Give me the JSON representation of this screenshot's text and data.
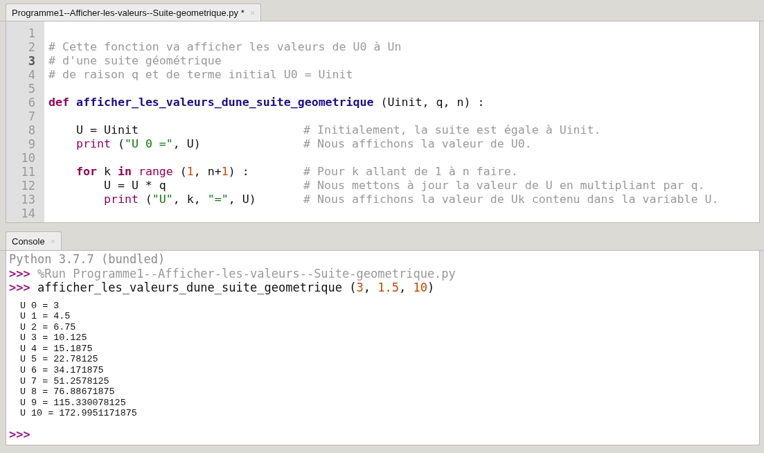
{
  "editor": {
    "tab": {
      "title": "Programme1--Afficher-les-valeurs--Suite-geometrique.py *"
    },
    "lines": [
      {
        "number": "1",
        "current": false
      },
      {
        "number": "2",
        "current": false,
        "tokens": [
          {
            "kind": "comment",
            "text": "# Cette fonction va afficher les valeurs de U0 à Un"
          }
        ]
      },
      {
        "number": "3",
        "current": true,
        "tokens": [
          {
            "kind": "comment",
            "text": "# d'une suite géométrique"
          }
        ]
      },
      {
        "number": "4",
        "current": false,
        "tokens": [
          {
            "kind": "comment",
            "text": "# de raison q et de terme initial U0 = Uinit"
          }
        ]
      },
      {
        "number": "5",
        "current": false
      },
      {
        "number": "6",
        "current": false,
        "tokens": [
          {
            "kind": "keyword",
            "text": "def"
          },
          {
            "kind": "defname",
            "text": " afficher_les_valeurs_dune_suite_geometrique"
          },
          {
            "kind": "plain",
            "text": " (Uinit, q, n) :"
          }
        ]
      },
      {
        "number": "7",
        "current": false
      },
      {
        "number": "8",
        "current": false,
        "tokens": [
          {
            "kind": "plain",
            "text": "    U = Uinit"
          }
        ],
        "comment": "# Initialement, la suite est égale à Uinit."
      },
      {
        "number": "9",
        "current": false,
        "tokens": [
          {
            "kind": "builtin",
            "text": "    print"
          },
          {
            "kind": "plain",
            "text": " ("
          },
          {
            "kind": "string",
            "text": "\"U 0 =\""
          },
          {
            "kind": "plain",
            "text": ", U)"
          }
        ],
        "comment": "# Nous affichons la valeur de U0."
      },
      {
        "number": "10",
        "current": false
      },
      {
        "number": "11",
        "current": false,
        "tokens": [
          {
            "kind": "keyword",
            "text": "    for"
          },
          {
            "kind": "plain",
            "text": " k "
          },
          {
            "kind": "keyword",
            "text": "in"
          },
          {
            "kind": "builtin",
            "text": " range"
          },
          {
            "kind": "plain",
            "text": " ("
          },
          {
            "kind": "number",
            "text": "1"
          },
          {
            "kind": "plain",
            "text": ", n+"
          },
          {
            "kind": "number",
            "text": "1"
          },
          {
            "kind": "plain",
            "text": ") :"
          }
        ],
        "comment": "# Pour k allant de 1 à n faire."
      },
      {
        "number": "12",
        "current": false,
        "tokens": [
          {
            "kind": "plain",
            "text": "        U = U * q"
          }
        ],
        "comment": "# Nous mettons à jour la valeur de U en multipliant par q."
      },
      {
        "number": "13",
        "current": false,
        "tokens": [
          {
            "kind": "builtin",
            "text": "        print"
          },
          {
            "kind": "plain",
            "text": " ("
          },
          {
            "kind": "string",
            "text": "\"U\""
          },
          {
            "kind": "plain",
            "text": ", k, "
          },
          {
            "kind": "string",
            "text": "\"=\""
          },
          {
            "kind": "plain",
            "text": ", U)"
          }
        ],
        "comment": "# Nous affichons la valeur de Uk contenu dans la variable U."
      },
      {
        "number": "14",
        "current": false
      }
    ]
  },
  "console": {
    "tab": {
      "title": "Console"
    },
    "lines": [
      {
        "kind": "banner",
        "text": "Python 3.7.7 (bundled)"
      },
      {
        "kind": "command",
        "prompt": ">>>",
        "tokens": [
          {
            "kind": "run",
            "text": "%Run Programme1--Afficher-les-valeurs--Suite-geometrique.py"
          }
        ]
      },
      {
        "kind": "command",
        "prompt": ">>>",
        "tokens": [
          {
            "kind": "plain",
            "text": "afficher_les_valeurs_dune_suite_geometrique ("
          },
          {
            "kind": "number",
            "text": "3"
          },
          {
            "kind": "plain",
            "text": ", "
          },
          {
            "kind": "number",
            "text": "1.5"
          },
          {
            "kind": "plain",
            "text": ", "
          },
          {
            "kind": "number",
            "text": "10"
          },
          {
            "kind": "plain",
            "text": ")"
          }
        ]
      },
      {
        "kind": "output",
        "text": "U 0 = 3"
      },
      {
        "kind": "output",
        "text": "U 1 = 4.5"
      },
      {
        "kind": "output",
        "text": "U 2 = 6.75"
      },
      {
        "kind": "output",
        "text": "U 3 = 10.125"
      },
      {
        "kind": "output",
        "text": "U 4 = 15.1875"
      },
      {
        "kind": "output",
        "text": "U 5 = 22.78125"
      },
      {
        "kind": "output",
        "text": "U 6 = 34.171875"
      },
      {
        "kind": "output",
        "text": "U 7 = 51.2578125"
      },
      {
        "kind": "output",
        "text": "U 8 = 76.88671875"
      },
      {
        "kind": "output",
        "text": "U 9 = 115.330078125"
      },
      {
        "kind": "output",
        "text": "U 10 = 172.9951171875"
      },
      {
        "kind": "prompt",
        "prompt": ">>>"
      }
    ]
  }
}
